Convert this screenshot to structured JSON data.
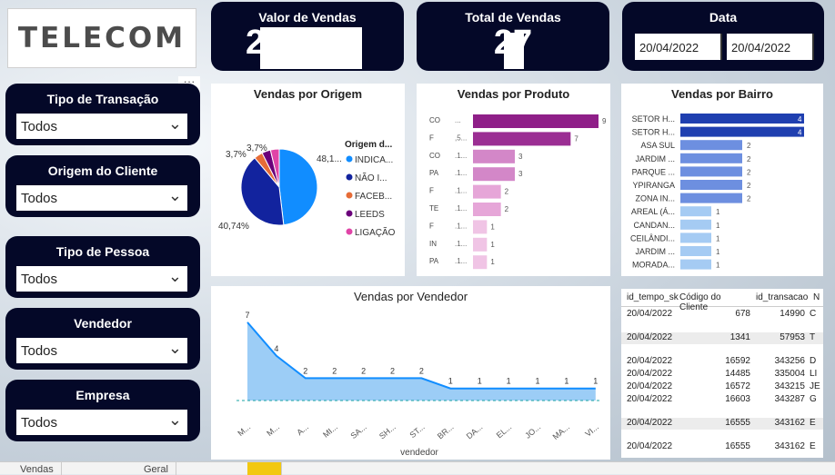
{
  "logo": {
    "text": "TELECOM"
  },
  "kpis": {
    "valor": {
      "label": "Valor de Vendas",
      "value": "2"
    },
    "total": {
      "label": "Total de Vendas",
      "value": "27"
    },
    "data": {
      "label": "Data",
      "start": "20/04/2022",
      "end": "20/04/2022"
    }
  },
  "slicers": [
    {
      "label": "Tipo de Transação",
      "value": "Todos"
    },
    {
      "label": "Origem do Cliente",
      "value": "Todos"
    },
    {
      "label": "Tipo de Pessoa",
      "value": "Todos"
    },
    {
      "label": "Vendedor",
      "value": "Todos"
    },
    {
      "label": "Empresa",
      "value": "Todos"
    }
  ],
  "more_label": "···",
  "origem": {
    "title": "Vendas por Origem",
    "legend_title": "Origem d...",
    "chart_data": {
      "type": "pie",
      "slices": [
        {
          "name": "INDICA...",
          "value": 48.15,
          "label": "48,1...",
          "color": "#118dff"
        },
        {
          "name": "NÃO I...",
          "value": 40.74,
          "label": "40,74%",
          "color": "#12239e"
        },
        {
          "name": "FACEB...",
          "value": 3.7,
          "label": "3,7%",
          "color": "#e66c37"
        },
        {
          "name": "LEEDS",
          "value": 3.7,
          "label": "3,7%",
          "color": "#6b007b"
        },
        {
          "name": "LIGAÇÃO",
          "value": 3.7,
          "label": "",
          "color": "#e044a7"
        }
      ]
    }
  },
  "produto": {
    "title": "Vendas por Produto",
    "chart_data": {
      "type": "bar",
      "orientation": "horizontal",
      "categories": [
        "CO",
        "F",
        "CO",
        "PA",
        "F",
        "TE",
        "F",
        "IN",
        "PA"
      ],
      "values": [
        9,
        7,
        3,
        3,
        2,
        2,
        1,
        1,
        1
      ]
    }
  },
  "bairro": {
    "title": "Vendas por Bairro",
    "chart_data": {
      "type": "bar",
      "orientation": "horizontal",
      "categories": [
        "SETOR H...",
        "SETOR H...",
        "ASA SUL",
        "JARDIM ...",
        "PARQUE ...",
        "YPIRANGA",
        "ZONA IN...",
        "AREAL (Á...",
        "CANDAN...",
        "CEILÂNDI...",
        "JARDIM ...",
        "MORADA..."
      ],
      "values": [
        4,
        4,
        2,
        2,
        2,
        2,
        2,
        1,
        1,
        1,
        1,
        1
      ]
    }
  },
  "vendedor": {
    "title": "Vendas por Vendedor",
    "xlabel": "vendedor",
    "chart_data": {
      "type": "area",
      "categories": [
        "M...",
        "M...",
        "A...",
        "MI...",
        "SA...",
        "SH...",
        "ST...",
        "BR...",
        "DA...",
        "EL...",
        "JO...",
        "MA...",
        "VI..."
      ],
      "values": [
        7,
        4,
        2,
        2,
        2,
        2,
        2,
        1,
        1,
        1,
        1,
        1,
        1
      ]
    }
  },
  "table": {
    "headers": [
      "id_tempo_sk",
      "Código do Cliente",
      "id_transacao",
      "N"
    ],
    "rows": [
      [
        "20/04/2022",
        "678",
        "14990",
        "C"
      ],
      [
        "20/04/2022",
        "1341",
        "57953",
        "T"
      ],
      [
        "20/04/2022",
        "16592",
        "343256",
        "D"
      ],
      [
        "20/04/2022",
        "14485",
        "335004",
        "LI"
      ],
      [
        "20/04/2022",
        "16572",
        "343215",
        "JE"
      ],
      [
        "20/04/2022",
        "16603",
        "343287",
        "G"
      ],
      [
        "20/04/2022",
        "16555",
        "343162",
        "E"
      ],
      [
        "20/04/2022",
        "16555",
        "343162",
        "E"
      ]
    ]
  },
  "tabs": [
    "Vendas",
    "Geral"
  ],
  "colors": {
    "navy": "#040828",
    "pie_blue": "#118dff",
    "bar_purple": "#9b2a8e",
    "bar_blue": "#1f3fb0",
    "area": "#9ccdf6"
  }
}
